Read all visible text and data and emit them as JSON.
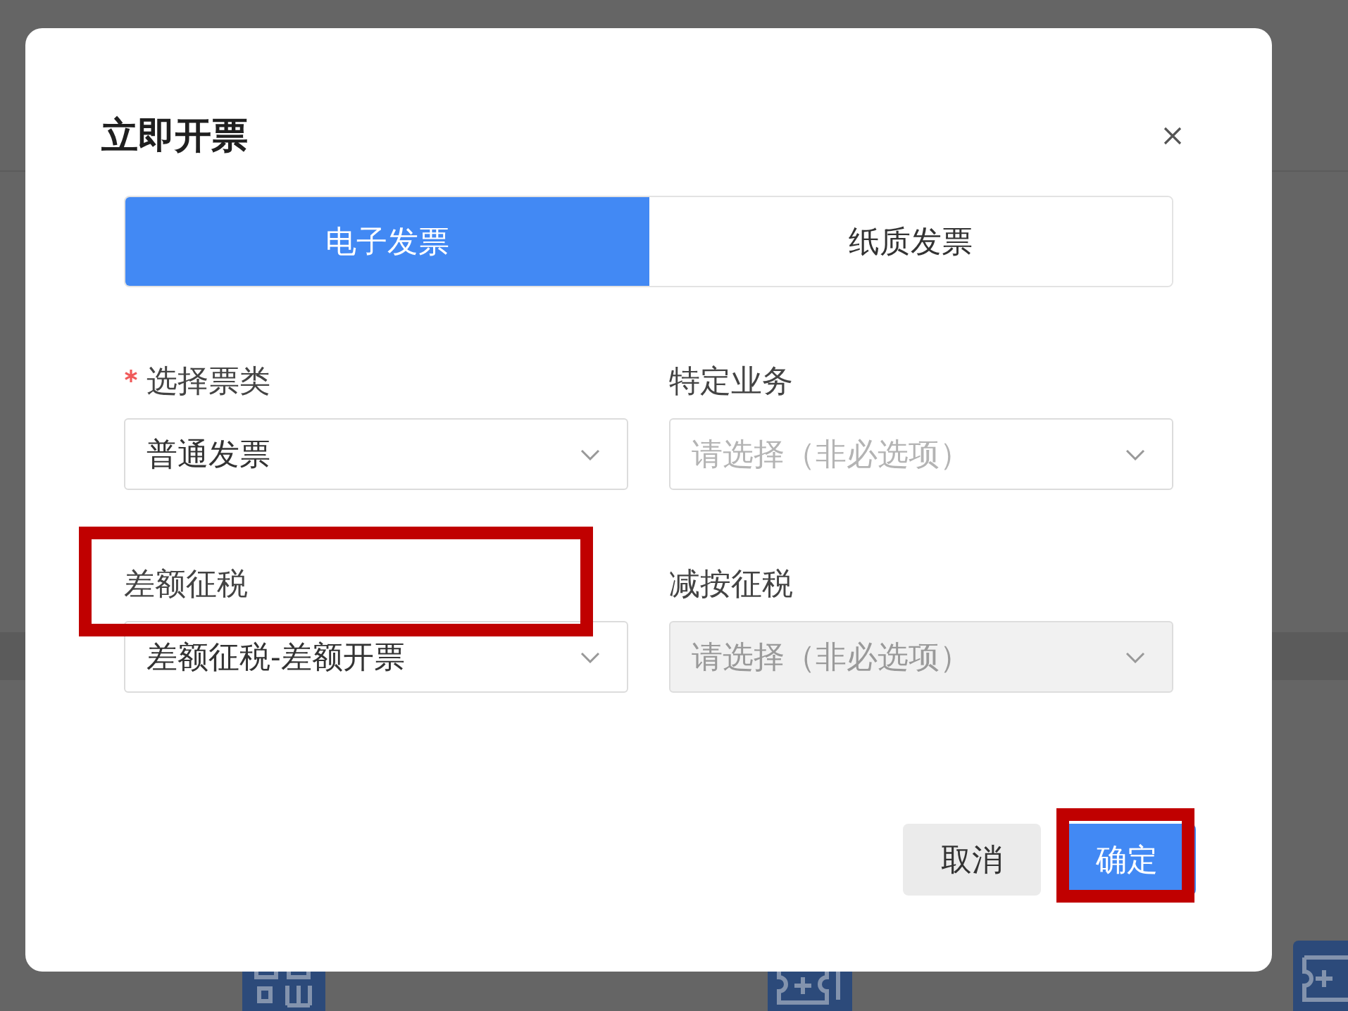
{
  "dialog": {
    "title": "立即开票"
  },
  "tabs": [
    {
      "label": "电子发票",
      "selected": true
    },
    {
      "label": "纸质发票",
      "selected": false
    }
  ],
  "form": {
    "fields": [
      {
        "label": "选择票类",
        "required": true,
        "value": "普通发票",
        "disabled": false,
        "highlighted": false
      },
      {
        "label": "特定业务",
        "required": false,
        "placeholder": "请选择（非必选项）",
        "disabled": false,
        "highlighted": false
      },
      {
        "label": "差额征税",
        "required": false,
        "value": "差额征税-差额开票",
        "disabled": false,
        "highlighted": true
      },
      {
        "label": "减按征税",
        "required": false,
        "placeholder": "请选择（非必选项）",
        "disabled": true,
        "highlighted": false
      }
    ]
  },
  "buttons": [
    {
      "label": "取消",
      "kind": "secondary",
      "highlighted": false
    },
    {
      "label": "确定",
      "kind": "primary",
      "highlighted": true
    }
  ]
}
